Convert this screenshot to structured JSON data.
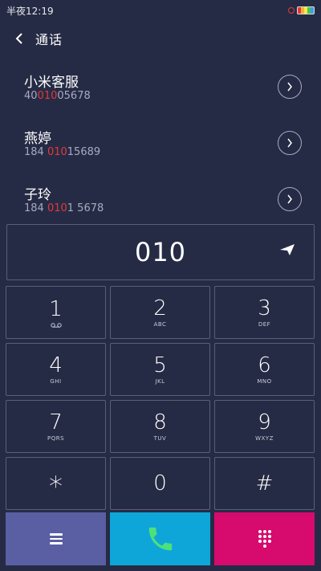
{
  "status_bar": {
    "time": "半夜12:19"
  },
  "header": {
    "title": "通话"
  },
  "contacts": [
    {
      "name": "小米客服",
      "number_pre": "40",
      "number_match": "010",
      "number_post": "05678"
    },
    {
      "name": "燕婷",
      "number_pre": "184 ",
      "number_match": "010",
      "number_post": "15689"
    },
    {
      "name": "子玲",
      "number_pre": "184 ",
      "number_match": "010",
      "number_post": "1 5678"
    }
  ],
  "dialer": {
    "number": "010"
  },
  "keypad": [
    {
      "digit": "1",
      "letters": ""
    },
    {
      "digit": "2",
      "letters": "ABC"
    },
    {
      "digit": "3",
      "letters": "DEF"
    },
    {
      "digit": "4",
      "letters": "GHI"
    },
    {
      "digit": "5",
      "letters": "JKL"
    },
    {
      "digit": "6",
      "letters": "MNO"
    },
    {
      "digit": "7",
      "letters": "PQRS"
    },
    {
      "digit": "8",
      "letters": "TUV"
    },
    {
      "digit": "9",
      "letters": "WXYZ"
    },
    {
      "digit": "*",
      "letters": ""
    },
    {
      "digit": "0",
      "letters": ""
    },
    {
      "digit": "#",
      "letters": ""
    }
  ],
  "colors": {
    "background": "#262b45",
    "highlight": "#e23a3a",
    "menu_button": "#5a5ea3",
    "call_button": "#0ea6d8",
    "dialpad_button": "#d70a6e",
    "phone_icon": "#4ee07a"
  },
  "icons": {
    "back": "chevron-left-icon",
    "detail": "chevron-right-icon",
    "send": "send-icon",
    "voicemail": "voicemail-icon",
    "menu": "menu-icon",
    "call": "phone-icon",
    "dialpad": "dialpad-icon"
  }
}
